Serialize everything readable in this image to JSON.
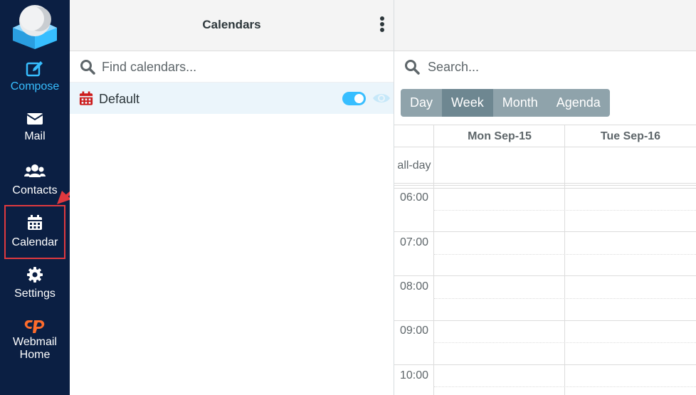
{
  "nav": {
    "items": [
      {
        "id": "compose",
        "label": "Compose",
        "icon": "edit-icon"
      },
      {
        "id": "mail",
        "label": "Mail",
        "icon": "envelope-icon"
      },
      {
        "id": "contacts",
        "label": "Contacts",
        "icon": "users-icon"
      },
      {
        "id": "calendar",
        "label": "Calendar",
        "icon": "calendar-icon"
      },
      {
        "id": "settings",
        "label": "Settings",
        "icon": "gear-icon"
      },
      {
        "id": "webmail_home",
        "label_line1": "Webmail",
        "label_line2": "Home",
        "icon": "cpanel-icon"
      }
    ]
  },
  "calendars_panel": {
    "title": "Calendars",
    "search_placeholder": "Find calendars...",
    "calendars": [
      {
        "name": "Default",
        "enabled": true
      }
    ]
  },
  "main": {
    "search_placeholder": "Search...",
    "views": [
      "Day",
      "Week",
      "Month",
      "Agenda"
    ],
    "active_view": "Week",
    "columns": [
      "Mon Sep-15",
      "Tue Sep-16"
    ],
    "all_day_label": "all-day",
    "hours": [
      "06:00",
      "07:00",
      "08:00",
      "09:00",
      "10:00"
    ]
  },
  "colors": {
    "nav_bg": "#0b1f43",
    "accent": "#37beff",
    "highlight": "#e0393f",
    "calendar_icon": "#cc1b1b",
    "cpanel_orange": "#ff6c2c"
  }
}
